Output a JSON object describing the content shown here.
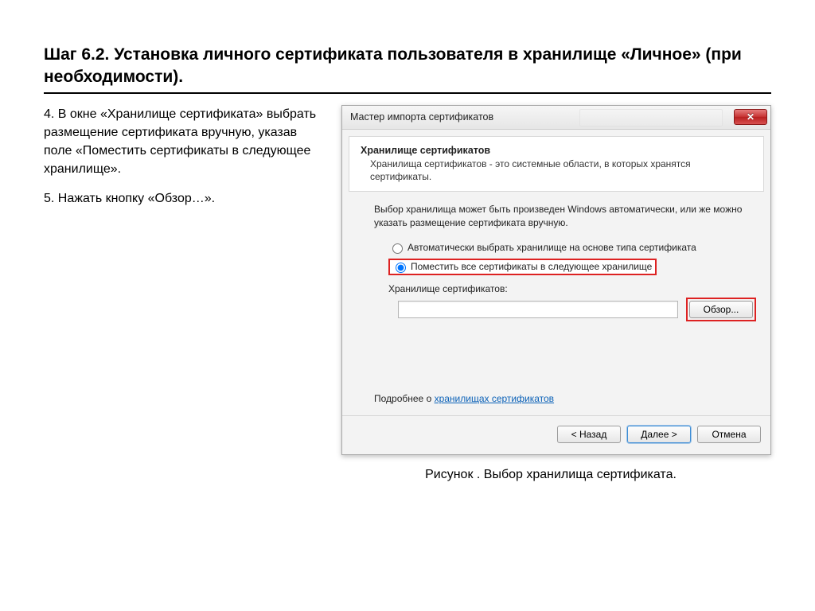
{
  "page": {
    "title": "Шаг 6.2. Установка личного сертификата пользователя в хранилище «Личное» (при необходимости)."
  },
  "instructions": {
    "p1": "4. В окне «Хранилище сертификата» выбрать размещение сертификата вручную, указав поле «Поместить сертификаты в следующее хранилище».",
    "p2": "5. Нажать кнопку «Обзор…»."
  },
  "dialog": {
    "title": "Мастер импорта сертификатов",
    "header_title": "Хранилище сертификатов",
    "header_desc": "Хранилища сертификатов - это системные области, в которых хранятся сертификаты.",
    "intro": "Выбор хранилища может быть произведен Windows автоматически, или же можно указать размещение сертификата вручную.",
    "radio_auto": "Автоматически выбрать хранилище на основе типа сертификата",
    "radio_manual": "Поместить все сертификаты в следующее хранилище",
    "store_label": "Хранилище сертификатов:",
    "browse_btn": "Обзор...",
    "link_prefix": "Подробнее о ",
    "link_text": "хранилищах сертификатов",
    "btn_back": "< Назад",
    "btn_next": "Далее >",
    "btn_cancel": "Отмена",
    "close_glyph": "✕"
  },
  "caption": "Рисунок . Выбор хранилища сертификата."
}
